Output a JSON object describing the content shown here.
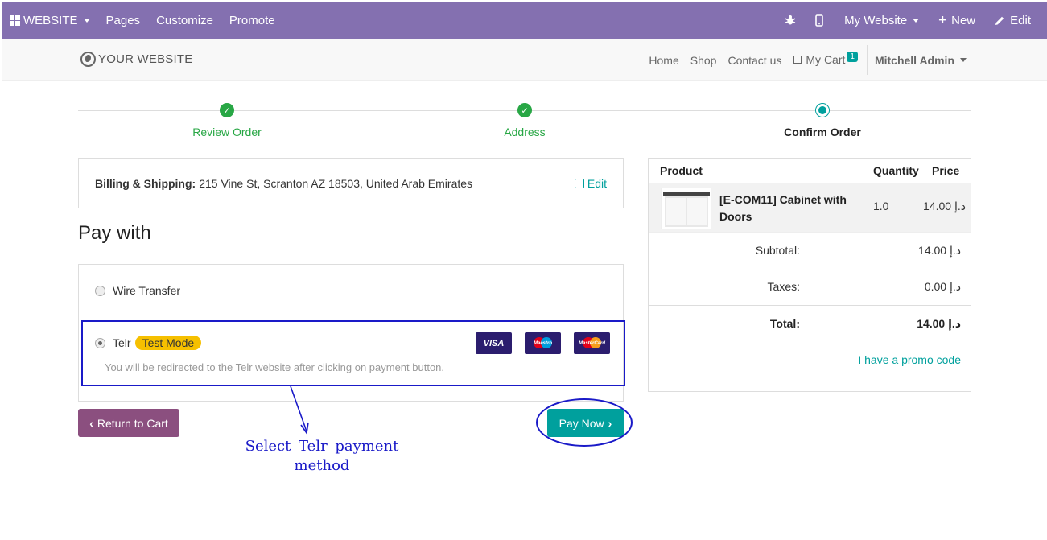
{
  "topbar": {
    "website_menu": "WEBSITE",
    "pages": "Pages",
    "customize": "Customize",
    "promote": "Promote",
    "my_website": "My Website",
    "new": "New",
    "edit": "Edit",
    "color": "#8470b0"
  },
  "header": {
    "logo": "YOUR WEBSITE",
    "nav": [
      "Home",
      "Shop",
      "Contact us"
    ],
    "cart_label": "My Cart",
    "cart_count": "1",
    "user": "Mitchell Admin"
  },
  "wizard": {
    "steps": [
      {
        "label": "Review Order",
        "state": "done"
      },
      {
        "label": "Address",
        "state": "done"
      },
      {
        "label": "Confirm Order",
        "state": "current"
      }
    ]
  },
  "billing": {
    "label": "Billing & Shipping:",
    "address": "215 Vine St, Scranton AZ 18503, United Arab Emirates",
    "edit": "Edit"
  },
  "payment": {
    "heading": "Pay with",
    "methods": [
      {
        "label": "Wire Transfer",
        "selected": false
      },
      {
        "label": "Telr",
        "badge": "Test Mode",
        "selected": true,
        "description": "You will be redirected to the Telr website after clicking on payment button."
      }
    ],
    "cards": [
      "VISA",
      "Maestro",
      "MasterCard"
    ]
  },
  "buttons": {
    "return_to_cart": "Return to Cart",
    "pay_now": "Pay Now"
  },
  "annotation": {
    "text_line1": "Select Telr payment",
    "text_line2": "method",
    "color": "#1a1ac8"
  },
  "summary": {
    "headers": [
      "Product",
      "Quantity",
      "Price"
    ],
    "product": {
      "name": "[E-COM11] Cabinet with Doors",
      "quantity": "1.0",
      "price": "14.00 د.إ"
    },
    "subtotal_label": "Subtotal:",
    "subtotal": "14.00 د.إ",
    "taxes_label": "Taxes:",
    "taxes": "0.00 د.إ",
    "total_label": "Total:",
    "total": "14.00 د.إ",
    "promo": "I have a promo code"
  }
}
